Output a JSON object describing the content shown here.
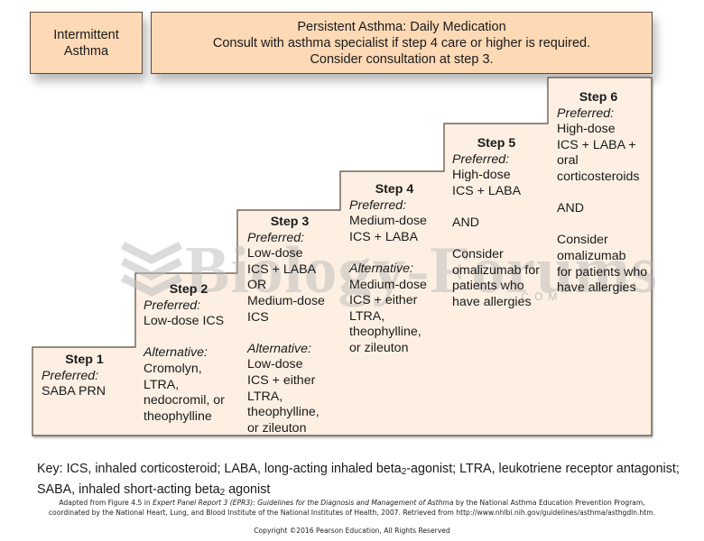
{
  "header": {
    "intermittent": {
      "line1": "Intermittent",
      "line2": "Asthma"
    },
    "persistent": {
      "line1": "Persistent Asthma:  Daily Medication",
      "line2": "Consult with asthma specialist if step 4 care or higher is required.",
      "line3": "Consider consultation at step 3."
    }
  },
  "steps": [
    {
      "title": "Step 1",
      "preferred_label": "Preferred:",
      "preferred": [
        "SABA PRN"
      ]
    },
    {
      "title": "Step 2",
      "preferred_label": "Preferred:",
      "preferred": [
        "Low-dose ICS"
      ],
      "alternative_label": "Alternative:",
      "alternative": [
        "Cromolyn,",
        "LTRA,",
        "nedocromil, or",
        "theophylline"
      ]
    },
    {
      "title": "Step 3",
      "preferred_label": "Preferred:",
      "preferred": [
        "Low-dose",
        "ICS + LABA",
        "OR",
        "Medium-dose",
        "ICS"
      ],
      "alternative_label": "Alternative:",
      "alternative": [
        "Low-dose",
        "ICS + either",
        "LTRA,",
        "theophylline,",
        "or zileuton"
      ]
    },
    {
      "title": "Step 4",
      "preferred_label": "Preferred:",
      "preferred": [
        "Medium-dose",
        "ICS + LABA"
      ],
      "alternative_label": "Alternative:",
      "alternative": [
        "Medium-dose",
        "ICS + either",
        "LTRA,",
        "theophylline,",
        "or zileuton"
      ]
    },
    {
      "title": "Step 5",
      "preferred_label": "Preferred:",
      "preferred": [
        "High-dose",
        "ICS + LABA"
      ],
      "and_label": "AND",
      "consider": [
        "Consider",
        "omalizumab for",
        "patients who",
        "have allergies"
      ]
    },
    {
      "title": "Step 6",
      "preferred_label": "Preferred:",
      "preferred": [
        "High-dose",
        "ICS + LABA +",
        "oral",
        "corticosteroids"
      ],
      "and_label": "AND",
      "consider": [
        "Consider",
        "omalizumab",
        "for patients who",
        "have allergies"
      ]
    }
  ],
  "watermark": {
    "text": "Biology-Forums",
    "suffix": ".COM"
  },
  "key": {
    "prefix": "Key:  ICS, inhaled corticosteroid; LABA, long-acting inhaled beta",
    "sub1": "2",
    "mid": "-agonist; LTRA, leukotriene receptor antagonist; SABA, inhaled short-acting beta",
    "sub2": "2",
    "suffix": " agonist"
  },
  "source": {
    "part1": "Adapted from Figure 4.5 in ",
    "title_italic": "Expert Panel Report 3 (EPR3): Guidelines for the Diagnosis and Management of Asthma",
    "part2": " by the National Asthma Education Prevention Program,",
    "line2": "coordinated by the National Heart, Lung, and Blood Institute of the National Institutes of Health, 2007.  Retrieved from http://www.nhlbi.nih.gov/guidelines/asthma/asthgdln.htm."
  },
  "copyright": "Copyright ©2016 Pearson Education, All Rights Reserved",
  "colors": {
    "header_fill": "#fdd9b5",
    "stairs_fill": "#fdf0e3",
    "border": "#5a4a3e"
  }
}
